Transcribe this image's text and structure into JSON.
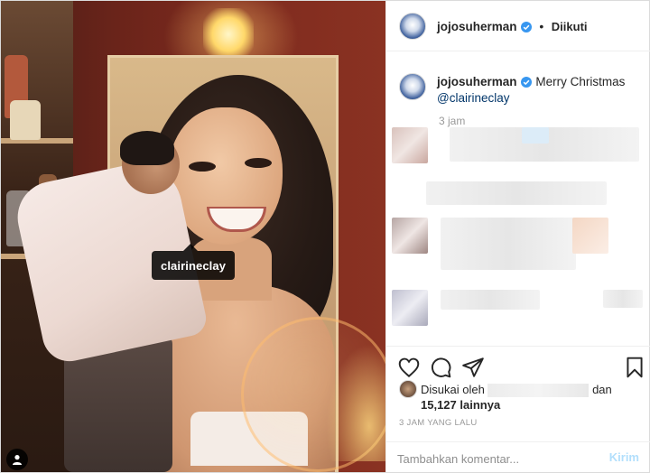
{
  "post": {
    "tagged_user": "clairineclay"
  },
  "header": {
    "username": "jojosuherman",
    "separator": "•",
    "follow_status": "Diikuti"
  },
  "caption": {
    "username": "jojosuherman",
    "text": "Merry Christmas",
    "mention": "@clairineclay",
    "time": "3 jam"
  },
  "likes": {
    "prefix": "Disukai oleh",
    "conjunction": "dan",
    "count": "15,127 lainnya"
  },
  "posted_time": "3 JAM YANG LALU",
  "comment": {
    "placeholder": "Tambahkan komentar...",
    "post_label": "Kirim"
  },
  "colors": {
    "verified": "#3897f0",
    "link": "#003569",
    "post_disabled": "#b2dffc"
  }
}
